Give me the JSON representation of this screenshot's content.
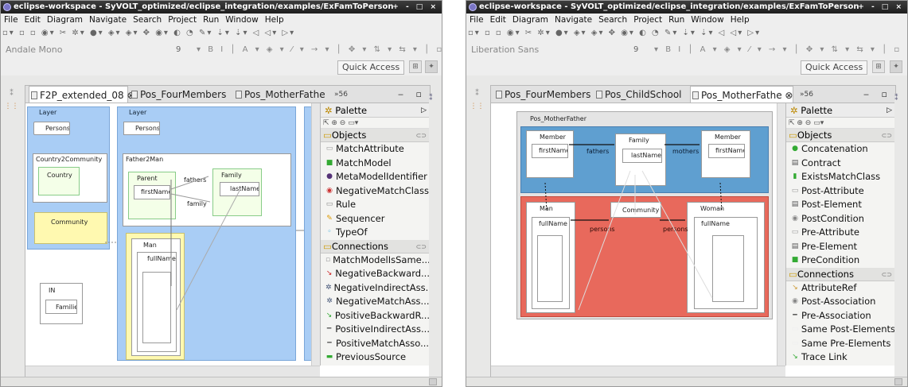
{
  "window_title": "eclipse-workspace - SyVOLT_optimized/eclipse_integration/examples/ExFamToPerson",
  "title_controls": "+ - □ ×",
  "menu": [
    "File",
    "Edit",
    "Diagram",
    "Navigate",
    "Search",
    "Project",
    "Run",
    "Window",
    "Help"
  ],
  "quick_access": "Quick Access",
  "left": {
    "font_name": "Andale Mono",
    "font_size": "9",
    "tabs": [
      "F2P_extended_08 ⊗",
      "Pos_FourMembers",
      "Pos_MotherFathe"
    ],
    "overflow": "»56",
    "palette": {
      "title": "Palette",
      "objects_label": "Objects",
      "objects": [
        "MatchAttribute",
        "MatchModel",
        "MetaModelIdentifier",
        "NegativeMatchClass",
        "Rule",
        "Sequencer",
        "TypeOf"
      ],
      "connections_label": "Connections",
      "connections": [
        "MatchModelIsSame...",
        "NegativeBackward...",
        "NegativeIndirectAss...",
        "NegativeMatchAss...",
        "PositiveBackwardR...",
        "PositiveIndirectAss...",
        "PositiveMatchAsso...",
        "PreviousSource"
      ]
    },
    "diagram": {
      "layer1": "Layer",
      "layer2": "Layer",
      "persons1": "Persons",
      "persons2": "Persons",
      "c2c": "Country2Community",
      "country": "Country",
      "community": "Community",
      "f2m": "Father2Man",
      "parent": "Parent",
      "family": "Family",
      "firstName": "firstName",
      "lastName": "lastName",
      "fathers": "fathers",
      "family_edge": "family",
      "man": "Man",
      "fullName": "fullName",
      "in": "IN",
      "families": "Families"
    }
  },
  "right": {
    "font_name": "Liberation Sans",
    "font_size": "9",
    "tabs": [
      "Pos_FourMembers",
      "Pos_ChildSchool",
      "Pos_MotherFathe ⊗"
    ],
    "overflow": "»56",
    "palette": {
      "title": "Palette",
      "objects_label": "Objects",
      "objects": [
        "Concatenation",
        "Contract",
        "ExistsMatchClass",
        "Post-Attribute",
        "Post-Element",
        "PostCondition",
        "Pre-Attribute",
        "Pre-Element",
        "PreCondition"
      ],
      "connections_label": "Connections",
      "connections": [
        "AttributeRef",
        "Post-Association",
        "Pre-Association",
        "Same Post-Elements",
        "Same Pre-Elements",
        "Trace Link"
      ]
    },
    "diagram": {
      "title": "Pos_MotherFather",
      "member1": "Member",
      "member2": "Member",
      "family": "Family",
      "firstName1": "firstName",
      "firstName2": "firstName",
      "lastName": "lastName",
      "fathers": "fathers",
      "mothers": "mothers",
      "man": "Man",
      "woman": "Woman",
      "community": "Community",
      "fullName1": "fullName",
      "fullName2": "fullName",
      "persons1": "persons",
      "persons2": "persons"
    }
  }
}
